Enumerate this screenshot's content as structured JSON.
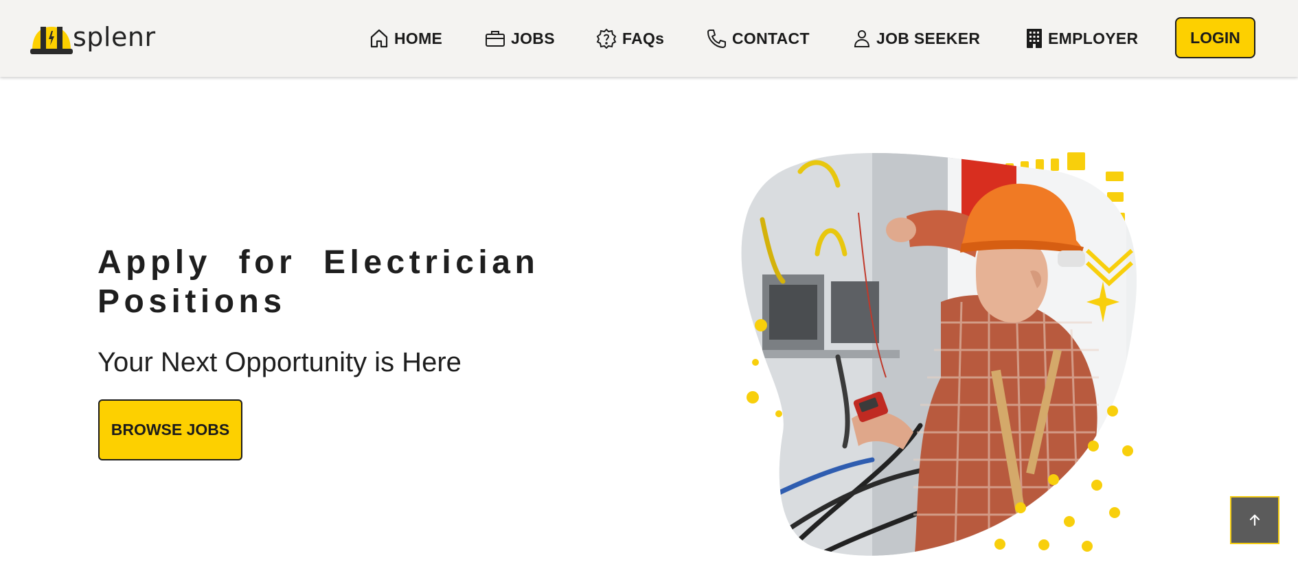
{
  "brand": {
    "name": "splenr"
  },
  "nav": {
    "home": "HOME",
    "jobs": "JOBS",
    "faqs": "FAQs",
    "contact": "CONTACT",
    "job_seeker": "JOB SEEKER",
    "employer": "EMPLOYER",
    "login": "LOGIN"
  },
  "hero": {
    "title": "Apply for Electrician Positions",
    "subtitle": "Your Next Opportunity is Here",
    "cta": "BROWSE JOBS",
    "image": "electrician-with-hard-hat-testing-panel"
  },
  "icons": {
    "home": "home-icon",
    "jobs": "briefcase-icon",
    "faqs": "question-badge-icon",
    "contact": "phone-icon",
    "job_seeker": "person-icon",
    "employer": "building-icon",
    "scroll_top": "arrow-up-icon"
  },
  "colors": {
    "accent": "#fdd000",
    "header_bg": "#f4f3f1",
    "text": "#1e1e1e",
    "scroll_btn": "#5b5b5b"
  }
}
